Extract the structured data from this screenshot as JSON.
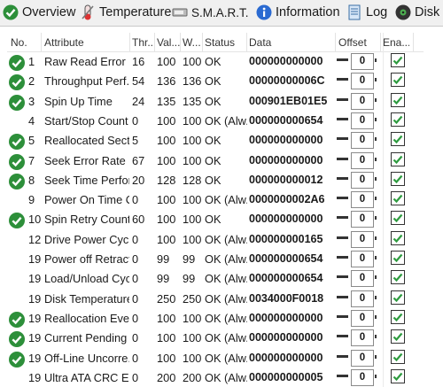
{
  "tabs": [
    {
      "label": "Overview",
      "icon": "check-circle-icon"
    },
    {
      "label": "Temperature",
      "icon": "thermometer-icon"
    },
    {
      "label": "S.M.A.R.T.",
      "icon": "drive-icon"
    },
    {
      "label": "Information",
      "icon": "info-icon"
    },
    {
      "label": "Log",
      "icon": "document-icon"
    },
    {
      "label": "Disk",
      "icon": "disk-icon"
    }
  ],
  "columns": [
    "No.",
    "Attribute",
    "Thr...",
    "Val...",
    "W...",
    "Status",
    "Data",
    "Offset",
    "Ena..."
  ],
  "rows": [
    {
      "ok": true,
      "no": "1",
      "attr": "Raw Read Error ...",
      "thr": "16",
      "val": "100",
      "worst": "100",
      "status": "OK",
      "data": "000000000000",
      "offset": "0"
    },
    {
      "ok": true,
      "no": "2",
      "attr": "Throughput Perf...",
      "thr": "54",
      "val": "136",
      "worst": "136",
      "status": "OK",
      "data": "00000000006C",
      "offset": "0"
    },
    {
      "ok": true,
      "no": "3",
      "attr": "Spin Up Time",
      "thr": "24",
      "val": "135",
      "worst": "135",
      "status": "OK",
      "data": "000901EB01E5",
      "offset": "0"
    },
    {
      "ok": false,
      "no": "4",
      "attr": "Start/Stop Count",
      "thr": "0",
      "val": "100",
      "worst": "100",
      "status": "OK (Alw...",
      "data": "000000000654",
      "offset": "0"
    },
    {
      "ok": true,
      "no": "5",
      "attr": "Reallocated Sect...",
      "thr": "5",
      "val": "100",
      "worst": "100",
      "status": "OK",
      "data": "000000000000",
      "offset": "0"
    },
    {
      "ok": true,
      "no": "7",
      "attr": "Seek Error Rate",
      "thr": "67",
      "val": "100",
      "worst": "100",
      "status": "OK",
      "data": "000000000000",
      "offset": "0"
    },
    {
      "ok": true,
      "no": "8",
      "attr": "Seek Time Perfor...",
      "thr": "20",
      "val": "128",
      "worst": "128",
      "status": "OK",
      "data": "000000000012",
      "offset": "0"
    },
    {
      "ok": false,
      "no": "9",
      "attr": "Power On Time C...",
      "thr": "0",
      "val": "100",
      "worst": "100",
      "status": "OK (Alw...",
      "data": "0000000002A6",
      "offset": "0"
    },
    {
      "ok": true,
      "no": "10",
      "attr": "Spin Retry Count",
      "thr": "60",
      "val": "100",
      "worst": "100",
      "status": "OK",
      "data": "000000000000",
      "offset": "0"
    },
    {
      "ok": false,
      "no": "12",
      "attr": "Drive Power Cycl...",
      "thr": "0",
      "val": "100",
      "worst": "100",
      "status": "OK (Alw...",
      "data": "000000000165",
      "offset": "0"
    },
    {
      "ok": false,
      "no": "19...",
      "attr": "Power off Retract...",
      "thr": "0",
      "val": "99",
      "worst": "99",
      "status": "OK (Alw...",
      "data": "000000000654",
      "offset": "0"
    },
    {
      "ok": false,
      "no": "19...",
      "attr": "Load/Unload Cyc...",
      "thr": "0",
      "val": "99",
      "worst": "99",
      "status": "OK (Alw...",
      "data": "000000000654",
      "offset": "0"
    },
    {
      "ok": false,
      "no": "19...",
      "attr": "Disk Temperature",
      "thr": "0",
      "val": "250",
      "worst": "250",
      "status": "OK (Alw...",
      "data": "0034000F0018",
      "offset": "0"
    },
    {
      "ok": true,
      "no": "19...",
      "attr": "Reallocation Eve...",
      "thr": "0",
      "val": "100",
      "worst": "100",
      "status": "OK (Alw...",
      "data": "000000000000",
      "offset": "0"
    },
    {
      "ok": true,
      "no": "19...",
      "attr": "Current Pending ...",
      "thr": "0",
      "val": "100",
      "worst": "100",
      "status": "OK (Alw...",
      "data": "000000000000",
      "offset": "0"
    },
    {
      "ok": true,
      "no": "19...",
      "attr": "Off-Line Uncorre...",
      "thr": "0",
      "val": "100",
      "worst": "100",
      "status": "OK (Alw...",
      "data": "000000000000",
      "offset": "0"
    },
    {
      "ok": false,
      "no": "19...",
      "attr": "Ultra ATA CRC Er...",
      "thr": "0",
      "val": "200",
      "worst": "200",
      "status": "OK (Alw...",
      "data": "000000000005",
      "offset": "0"
    }
  ],
  "colors": {
    "ok_green": "#2d8f3a",
    "check_green": "#2e9b3f"
  }
}
